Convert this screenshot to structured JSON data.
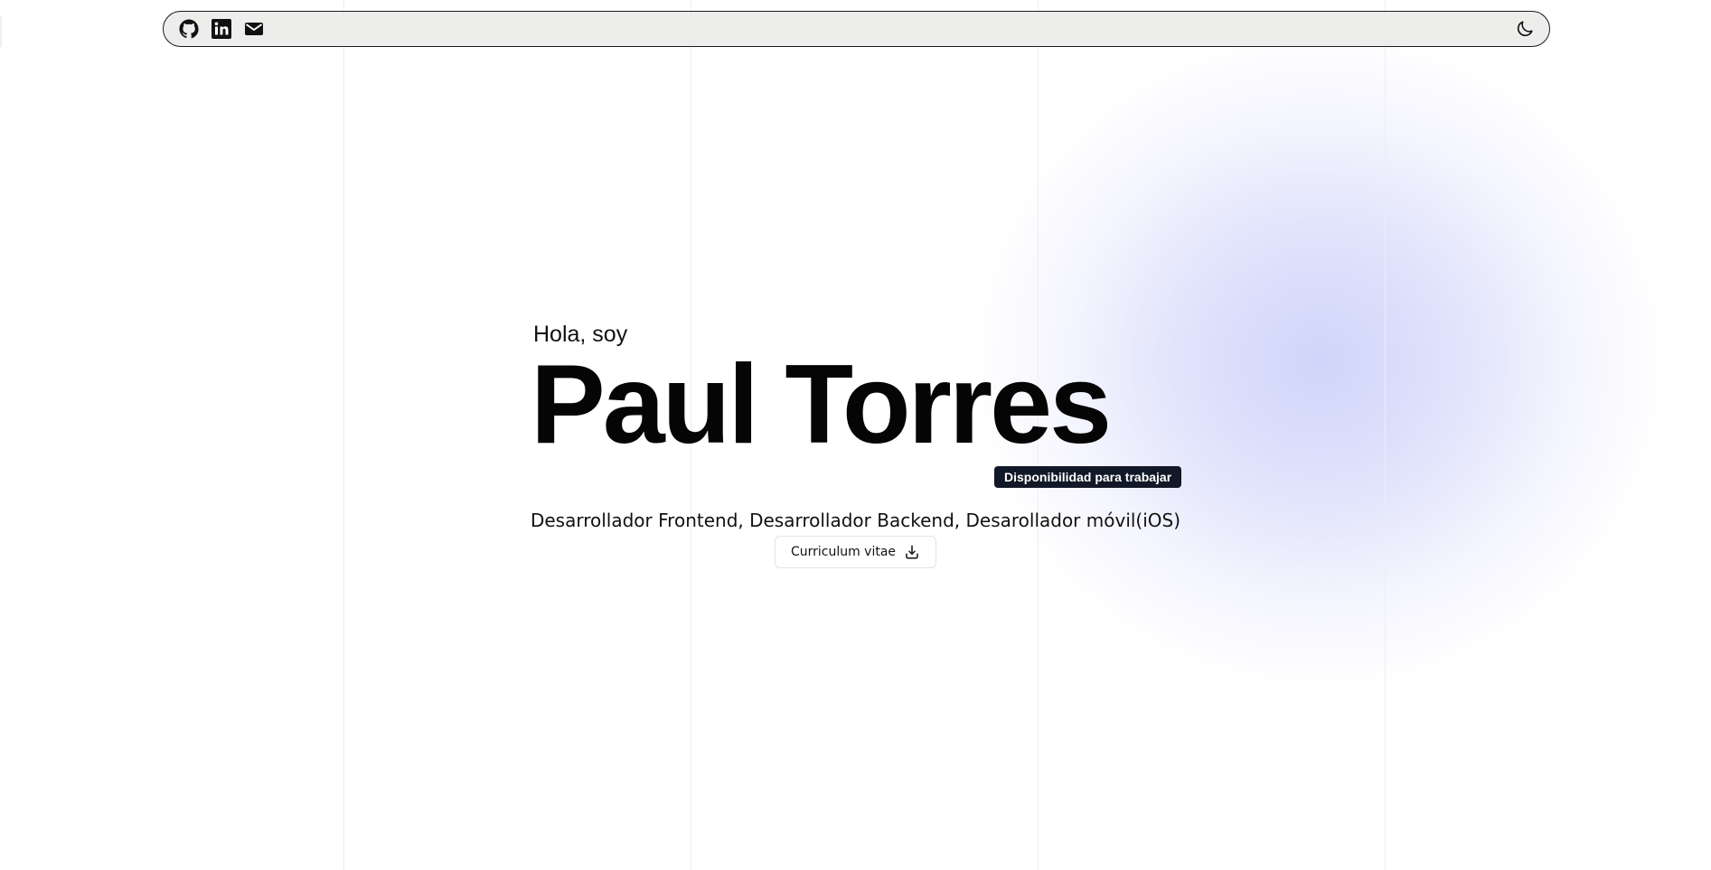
{
  "nav": {
    "icons": [
      "github-icon",
      "linkedin-icon",
      "mail-icon"
    ],
    "theme_toggle_icon": "moon-icon"
  },
  "hero": {
    "greeting": "Hola, soy",
    "name": "Paul Torres",
    "badge": "Disponibilidad para trabajar",
    "roles": "Desarrollador Frontend, Desarrollador Backend, Desarollador móvil(iOS)",
    "cv_button_label": "Curriculum vitae",
    "cv_button_icon": "download-icon"
  },
  "colors": {
    "badge_bg": "#111827",
    "accent_blob": "#c8cdf8",
    "navbar_bg": "#ecebea"
  }
}
